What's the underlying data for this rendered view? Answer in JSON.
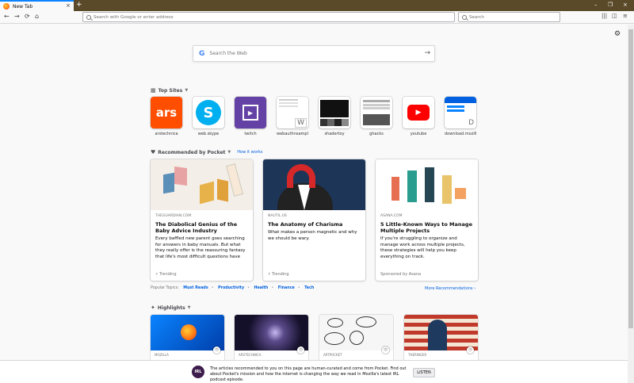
{
  "tab": {
    "title": "New Tab",
    "close": "×"
  },
  "new_tab": "+",
  "window_controls": {
    "minimize": "–",
    "maximize": "❐",
    "close": "×"
  },
  "nav": {
    "back": "←",
    "forward": "→",
    "reload": "⟳",
    "home": "⌂"
  },
  "url_bar": {
    "placeholder": "Search with Google or enter address"
  },
  "search_bar": {
    "placeholder": "Search"
  },
  "web_search": {
    "logo": "G",
    "placeholder": "Search the Web",
    "arrow": "→"
  },
  "top_sites": {
    "title": "Top Sites",
    "items": [
      {
        "label": "arstechnica",
        "text": "ars",
        "bg": "#ff4e00",
        "fg": "#ffffff"
      },
      {
        "label": "web.skype",
        "text": "S",
        "bg": "#ffffff",
        "fg": "#00aff0"
      },
      {
        "label": "twitch",
        "text": "▶",
        "bg": "#6441a5",
        "fg": "#ffffff"
      },
      {
        "label": "webauthnsample",
        "text": "W",
        "bg": "#ffffff",
        "fg": "#666666"
      },
      {
        "label": "shadertoy",
        "text": "",
        "bg": "#222222",
        "fg": "#ffffff"
      },
      {
        "label": "ghacks",
        "text": "",
        "bg": "#ffffff",
        "fg": "#444444"
      },
      {
        "label": "youtube",
        "text": "▶",
        "bg": "#ffffff",
        "fg": "#ff0000"
      },
      {
        "label": "download.mozilla",
        "text": "D",
        "bg": "#ffffff",
        "fg": "#0060df"
      }
    ]
  },
  "pocket": {
    "title": "Recommended by Pocket",
    "how_link": "How it works",
    "cards": [
      {
        "source": "THEGUARDIAN.COM",
        "title": "The Diabolical Genius of the Baby Advice Industry",
        "desc": "Every baffled new parent goes searching for answers in baby manuals. But what they really offer is the reassuring fantasy that life's most difficult questions have",
        "context": "Trending"
      },
      {
        "source": "NAUTIL.US",
        "title": "The Anatomy of Charisma",
        "desc": "What makes a person magnetic and why we should be wary.",
        "context": "Trending"
      },
      {
        "source": "ASANA.COM",
        "title": "5 Little-Known Ways to Manage Multiple Projects",
        "desc": "If you're struggling to organize and manage work across multiple projects, these strategies will help you keep everything on track.",
        "context": "Sponsored by Asana"
      }
    ],
    "popular_label": "Popular Topics:",
    "topics": [
      "Must Reads",
      "Productivity",
      "Health",
      "Finance",
      "Tech"
    ],
    "more": "More Recommendations ›"
  },
  "highlights": {
    "title": "Highlights",
    "items": [
      {
        "source": "MOZILLA"
      },
      {
        "source": "ARSTECHNICA"
      },
      {
        "source": "ARTPOCKET"
      },
      {
        "source": "THERINGER"
      }
    ]
  },
  "footer": {
    "logo": "IRL",
    "message": "The articles recommended to you on this page are human-curated and come from Pocket. Find out about Pocket's mission and how the internet is changing the way we read in Mozilla's latest IRL podcast episode.",
    "button": "LISTEN"
  },
  "settings_icon": "⚙"
}
